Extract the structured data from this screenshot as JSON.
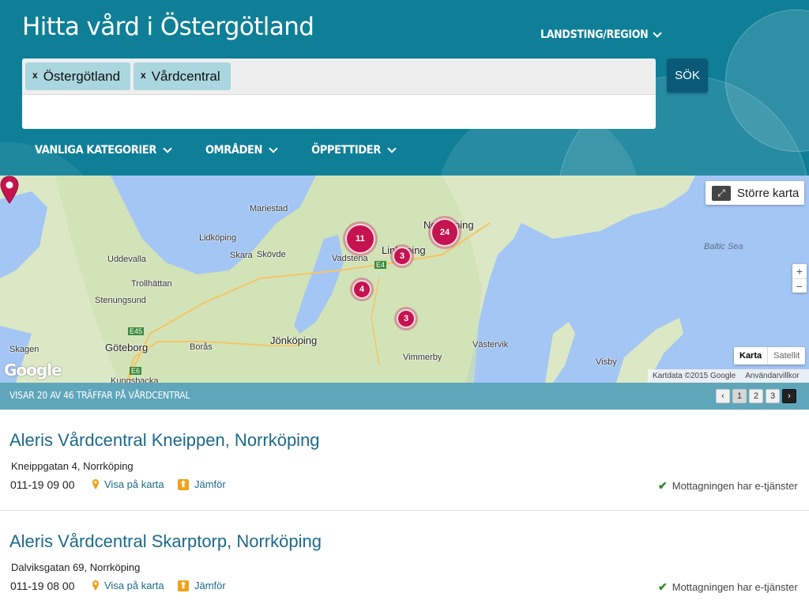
{
  "header": {
    "title": "Hitta vård i Östergötland",
    "region_label": "LANDSTING/REGION",
    "search": {
      "tags": [
        {
          "remove": "x",
          "label": "Östergötland"
        },
        {
          "remove": "x",
          "label": "Vårdcentral"
        }
      ],
      "input_value": "",
      "button_label": "SÖK"
    },
    "categories": [
      {
        "label": "VANLIGA KATEGORIER"
      },
      {
        "label": "OMRÅDEN"
      },
      {
        "label": "ÖPPETTIDER"
      }
    ],
    "colors": {
      "header_bg": "#0f7f98",
      "tag_bg": "#a9d6df",
      "button_bg": "#0a5a77"
    }
  },
  "map": {
    "bigger_map_label": "Större karta",
    "zoom_in": "+",
    "zoom_out": "−",
    "map_type": {
      "map": "Karta",
      "satellite": "Satellit"
    },
    "logo": "Google",
    "attribution": "Kartdata ©2015 Google",
    "terms": "Användarvillkor",
    "places": [
      {
        "name": "Mariestad"
      },
      {
        "name": "Lidköping"
      },
      {
        "name": "Uddevalla"
      },
      {
        "name": "Skara"
      },
      {
        "name": "Skövde"
      },
      {
        "name": "Vadstena"
      },
      {
        "name": "Linköping"
      },
      {
        "name": "Norrköping"
      },
      {
        "name": "Trollhättan"
      },
      {
        "name": "Stenungsund"
      },
      {
        "name": "Jönköping"
      },
      {
        "name": "Skagen"
      },
      {
        "name": "Göteborg"
      },
      {
        "name": "Borås"
      },
      {
        "name": "Västervik"
      },
      {
        "name": "Vimmerby"
      },
      {
        "name": "Visby"
      },
      {
        "name": "Kungsbacka"
      }
    ],
    "sea": "Baltic Sea",
    "roads": {
      "e4": "E4",
      "e45": "E45",
      "e6": "E6"
    },
    "clusters": [
      {
        "count": "11"
      },
      {
        "count": "24"
      },
      {
        "count": "3"
      },
      {
        "count": "4"
      },
      {
        "count": "3"
      }
    ],
    "cluster_color": "#c4134f"
  },
  "results": {
    "summary": "VISAR 20 AV 46 TRÄFFAR PÅ VÅRDCENTRAL",
    "pager": {
      "prev": "‹",
      "pages": [
        "1",
        "2",
        "3"
      ],
      "next": "›",
      "current_page": "1"
    },
    "items": [
      {
        "name": "Aleris Vårdcentral Kneippen, Norrköping",
        "address": "Kneippgatan 4, Norrköping",
        "phone": "011-19 09 00",
        "map_link": "Visa på karta",
        "compare_link": "Jämför",
        "eservice": "Mottagningen har e-tjänster"
      },
      {
        "name": "Aleris Vårdcentral Skarptorp, Norrköping",
        "address": "Dalviksgatan 69, Norrköping",
        "phone": "011-19 08 00",
        "map_link": "Visa på karta",
        "compare_link": "Jämför",
        "eservice": "Mottagningen har e-tjänster"
      }
    ]
  }
}
